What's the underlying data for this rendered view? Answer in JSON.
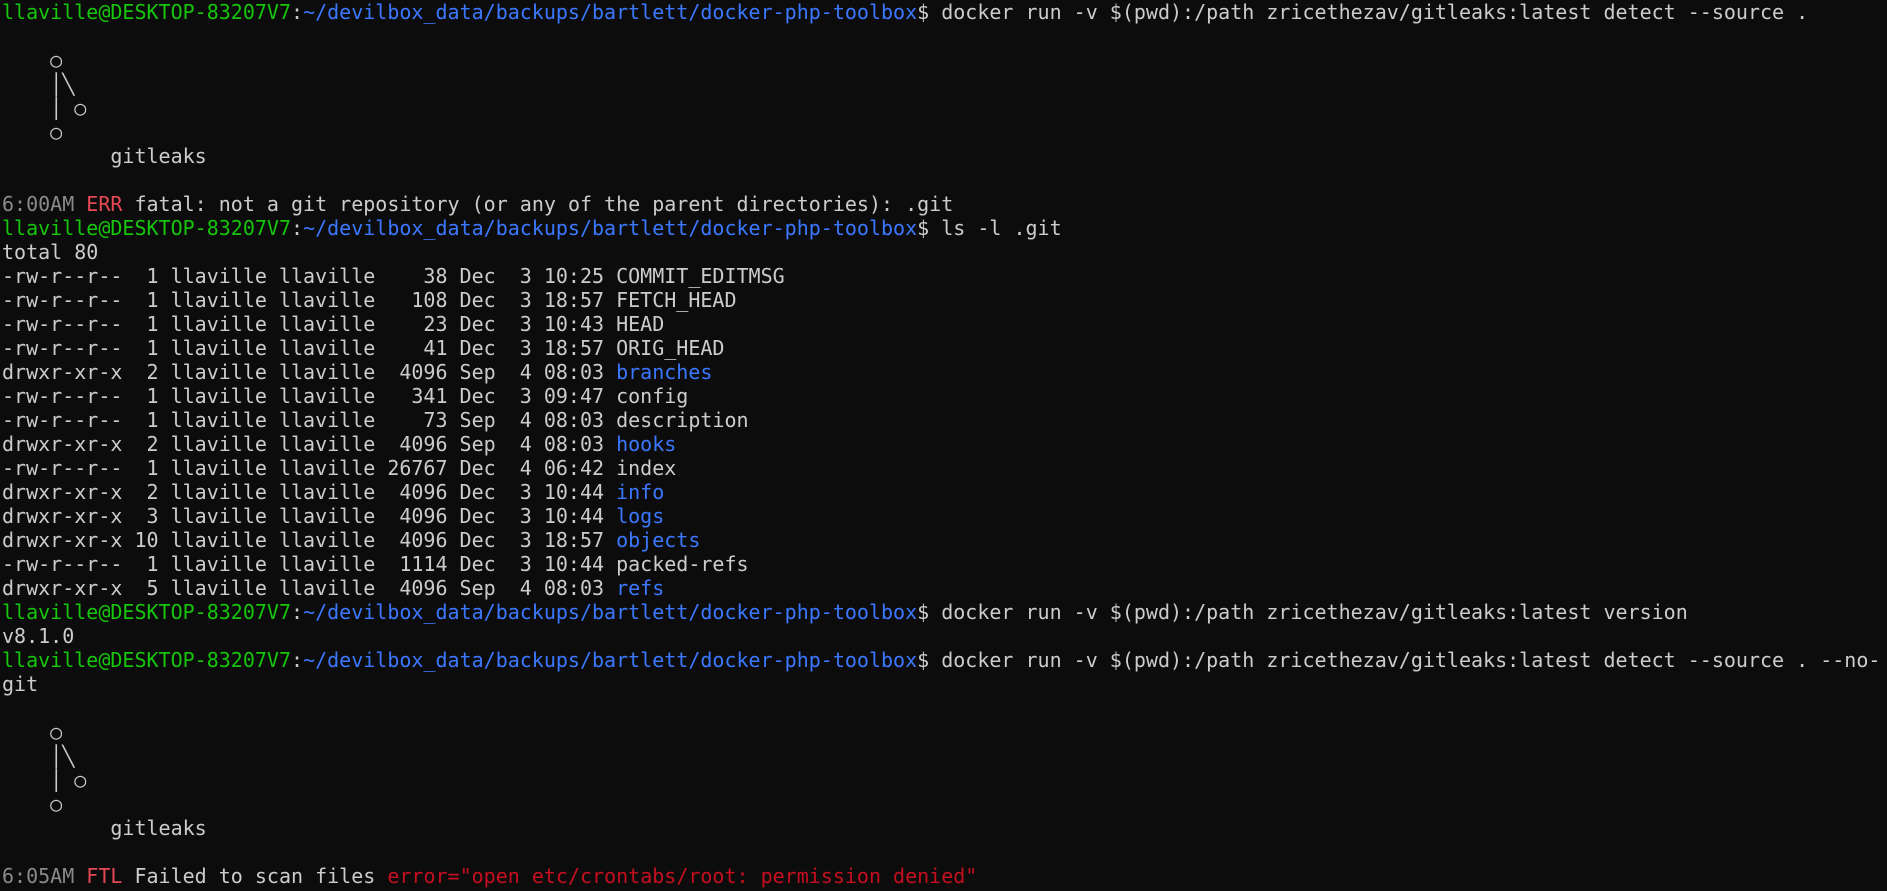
{
  "colors": {
    "background": "#0c0c0c",
    "foreground": "#cccccc",
    "prompt_user": "#16c60c",
    "prompt_path": "#3b78ff",
    "directory": "#3b78ff",
    "level_err": "#e74856",
    "level_ftl": "#e74856",
    "error_text": "#c50f1f",
    "timestamp": "#8a8a8a"
  },
  "prompt": {
    "user_host": "llaville@DESKTOP-83207V7",
    "separator": ":",
    "path": "~/devilbox_data/backups/bartlett/docker-php-toolbox",
    "symbol": "$"
  },
  "commands": {
    "cmd1": " docker run -v $(pwd):/path zricethezav/gitleaks:latest detect --source .",
    "cmd2": " ls -l .git",
    "cmd3": " docker run -v $(pwd):/path zricethezav/gitleaks:latest version",
    "cmd4": " docker run -v $(pwd):/path zricethezav/gitleaks:latest detect --source . --no-",
    "cmd4_wrap": "git"
  },
  "logo": {
    "l1": "    ○",
    "l2": "    │╲",
    "l3": "    │ ○",
    "l4": "    ○",
    "name": "         gitleaks"
  },
  "log1": {
    "time": "6:00AM",
    "level": "ERR",
    "message": " fatal: not a git repository (or any of the parent directories): .git"
  },
  "version_output": "v8.1.0",
  "log2": {
    "time": "6:05AM",
    "level": "FTL",
    "message": " Failed to scan files ",
    "error": "error=\"open etc/crontabs/root: permission denied\""
  },
  "listing": {
    "total": "total 80",
    "rows": [
      {
        "meta": "-rw-r--r--  1 llaville llaville    38 Dec  3 10:25 ",
        "name": "COMMIT_EDITMSG",
        "dir": false
      },
      {
        "meta": "-rw-r--r--  1 llaville llaville   108 Dec  3 18:57 ",
        "name": "FETCH_HEAD",
        "dir": false
      },
      {
        "meta": "-rw-r--r--  1 llaville llaville    23 Dec  3 10:43 ",
        "name": "HEAD",
        "dir": false
      },
      {
        "meta": "-rw-r--r--  1 llaville llaville    41 Dec  3 18:57 ",
        "name": "ORIG_HEAD",
        "dir": false
      },
      {
        "meta": "drwxr-xr-x  2 llaville llaville  4096 Sep  4 08:03 ",
        "name": "branches",
        "dir": true
      },
      {
        "meta": "-rw-r--r--  1 llaville llaville   341 Dec  3 09:47 ",
        "name": "config",
        "dir": false
      },
      {
        "meta": "-rw-r--r--  1 llaville llaville    73 Sep  4 08:03 ",
        "name": "description",
        "dir": false
      },
      {
        "meta": "drwxr-xr-x  2 llaville llaville  4096 Sep  4 08:03 ",
        "name": "hooks",
        "dir": true
      },
      {
        "meta": "-rw-r--r--  1 llaville llaville 26767 Dec  4 06:42 ",
        "name": "index",
        "dir": false
      },
      {
        "meta": "drwxr-xr-x  2 llaville llaville  4096 Dec  3 10:44 ",
        "name": "info",
        "dir": true
      },
      {
        "meta": "drwxr-xr-x  3 llaville llaville  4096 Dec  3 10:44 ",
        "name": "logs",
        "dir": true
      },
      {
        "meta": "drwxr-xr-x 10 llaville llaville  4096 Dec  3 18:57 ",
        "name": "objects",
        "dir": true
      },
      {
        "meta": "-rw-r--r--  1 llaville llaville  1114 Dec  3 10:44 ",
        "name": "packed-refs",
        "dir": false
      },
      {
        "meta": "drwxr-xr-x  5 llaville llaville  4096 Sep  4 08:03 ",
        "name": "refs",
        "dir": true
      }
    ]
  }
}
